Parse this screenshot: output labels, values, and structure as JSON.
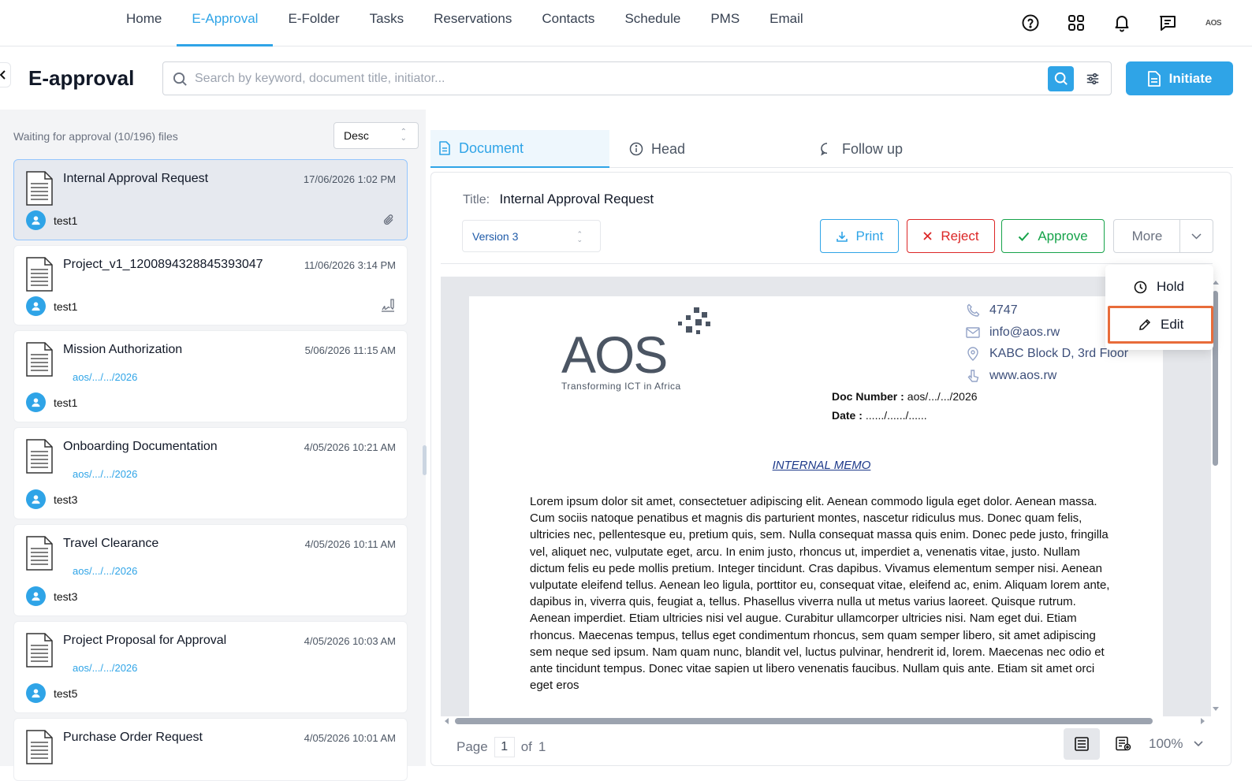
{
  "nav": {
    "items": [
      "Home",
      "E-Approval",
      "E-Folder",
      "Tasks",
      "Reservations",
      "Contacts",
      "Schedule",
      "PMS",
      "Email"
    ],
    "active": "E-Approval",
    "icons": [
      "help-icon",
      "apps-grid-icon",
      "bell-icon",
      "chat-icon"
    ],
    "brand_mini": "AOS"
  },
  "header": {
    "title": "E-approval",
    "search_placeholder": "Search by keyword, document title, initiator...",
    "initiate_label": "Initiate"
  },
  "list": {
    "count_label": "Waiting for approval (10/196) files",
    "sort_value": "Desc",
    "items": [
      {
        "title": "Internal Approval Request",
        "date": "17/06/2026 1:02 PM",
        "ref": "",
        "user": "test1",
        "meta_icon": "paperclip-icon"
      },
      {
        "title": "Project_v1_1200894328845393047",
        "date": "11/06/2026 3:14 PM",
        "ref": "",
        "user": "test1",
        "meta_icon": "signature-icon"
      },
      {
        "title": "Mission Authorization",
        "date": "5/06/2026 11:15 AM",
        "ref": "aos/.../.../2026",
        "user": "test1",
        "meta_icon": ""
      },
      {
        "title": "Onboarding Documentation",
        "date": "4/05/2026 10:21 AM",
        "ref": "aos/.../.../2026",
        "user": "test3",
        "meta_icon": ""
      },
      {
        "title": "Travel Clearance",
        "date": "4/05/2026 10:11 AM",
        "ref": "aos/.../.../2026",
        "user": "test3",
        "meta_icon": ""
      },
      {
        "title": "Project Proposal for Approval",
        "date": "4/05/2026 10:03 AM",
        "ref": "aos/.../.../2026",
        "user": "test5",
        "meta_icon": ""
      },
      {
        "title": "Purchase Order Request",
        "date": "4/05/2026 10:01 AM",
        "ref": "",
        "user": "",
        "meta_icon": ""
      }
    ]
  },
  "tabs": [
    {
      "label": "Document",
      "icon": "document-icon",
      "active": true
    },
    {
      "label": "Head",
      "icon": "info-icon",
      "active": false
    },
    {
      "label": "Follow up",
      "icon": "comment-icon",
      "active": false
    }
  ],
  "detail": {
    "title_label": "Title:",
    "title_value": "Internal Approval Request",
    "version": "Version 3",
    "print_label": "Print",
    "reject_label": "Reject",
    "approve_label": "Approve",
    "more_label": "More",
    "menu": {
      "hold_label": "Hold",
      "edit_label": "Edit"
    }
  },
  "document": {
    "logo_text": "AOS",
    "logo_tagline": "Transforming ICT in Africa",
    "phone": "4747",
    "email": "info@aos.rw",
    "address": "KABC Block D, 3rd Floor",
    "website": "www.aos.rw",
    "doc_number_label": "Doc  Number  :",
    "doc_number_value": "aos/.../.../2026",
    "date_label": "Date  :",
    "date_value": "....../....../......",
    "memo_title": "INTERNAL MEMO",
    "body": "Lorem ipsum dolor sit amet, consectetuer adipiscing elit. Aenean commodo ligula eget dolor. Aenean massa. Cum sociis natoque penatibus et magnis dis parturient montes, nascetur ridiculus mus. Donec quam felis, ultricies nec, pellentesque eu, pretium quis, sem. Nulla consequat massa quis enim. Donec pede justo, fringilla vel, aliquet nec, vulputate eget, arcu. In enim justo, rhoncus ut, imperdiet a, venenatis vitae, justo. Nullam dictum felis eu pede mollis pretium. Integer tincidunt. Cras dapibus. Vivamus elementum semper nisi. Aenean vulputate eleifend tellus. Aenean leo ligula, porttitor eu, consequat vitae, eleifend ac, enim. Aliquam lorem ante, dapibus in, viverra quis, feugiat a, tellus. Phasellus viverra nulla ut metus varius laoreet. Quisque rutrum. Aenean imperdiet. Etiam ultricies nisi vel augue. Curabitur ullamcorper ultricies nisi. Nam eget dui. Etiam rhoncus. Maecenas tempus, tellus eget condimentum rhoncus, sem quam semper libero, sit amet adipiscing sem neque sed ipsum. Nam quam nunc, blandit vel, luctus pulvinar, hendrerit id, lorem. Maecenas nec odio et ante tincidunt tempus. Donec vitae sapien ut libero venenatis faucibus. Nullam quis ante. Etiam sit amet orci eget eros"
  },
  "footer": {
    "page_label": "Page",
    "page_value": "1",
    "of_label": "of",
    "total_pages": "1",
    "zoom": "100%"
  },
  "colors": {
    "accent": "#2fa4e7",
    "reject": "#dc2626",
    "approve": "#16a34a",
    "highlight": "#e86c3a"
  }
}
